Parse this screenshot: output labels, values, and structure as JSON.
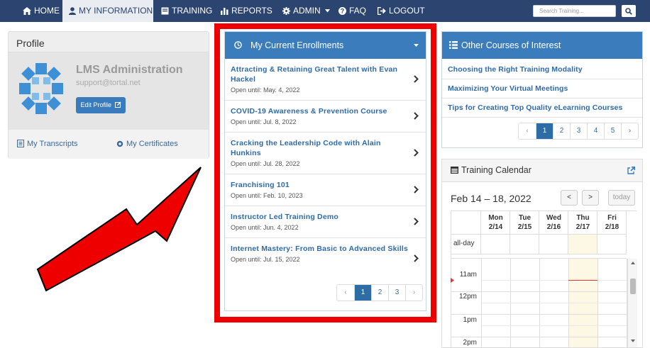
{
  "nav": {
    "home": "HOME",
    "my_information": "MY INFORMATION",
    "training": "TRAINING",
    "reports": "REPORTS",
    "admin": "ADMIN",
    "faq": "FAQ",
    "logout": "LOGOUT",
    "search_placeholder": "Search Training..."
  },
  "profile": {
    "title": "Profile",
    "name": "LMS Administration",
    "email": "support@tortal.net",
    "edit_label": "Edit Profile",
    "transcripts_label": "My Transcripts",
    "certificates_label": "My Certificates"
  },
  "enrollments": {
    "title": "My Current Enrollments",
    "items": [
      {
        "title": "Attracting & Retaining Great Talent with Evan Hackel",
        "date": "Open until: May. 4, 2022"
      },
      {
        "title": "COVID-19 Awareness & Prevention Course",
        "date": "Open until: Jul. 8, 2022"
      },
      {
        "title": "Cracking the Leadership Code with Alain Hunkins",
        "date": "Open until: Jul. 28, 2022"
      },
      {
        "title": "Franchising 101",
        "date": "Open until: Feb. 10, 2023"
      },
      {
        "title": "Instructor Led Training Demo",
        "date": "Open until: Jun. 4, 2022"
      },
      {
        "title": "Internet Mastery: From Basic to Advanced Skills",
        "date": "Open until: Jul. 15, 2022"
      }
    ],
    "pager": {
      "prev": "‹",
      "pages": [
        "1",
        "2",
        "3"
      ],
      "next": "›",
      "active": "1"
    }
  },
  "other_courses": {
    "title": "Other Courses of Interest",
    "items": [
      "Choosing the Right Training Modality",
      "Maximizing Your Virtual Meetings",
      "Tips for Creating Top Quality eLearning Courses"
    ],
    "pager": {
      "prev": "‹",
      "pages": [
        "1",
        "2",
        "3",
        "4",
        "5"
      ],
      "next": "›",
      "active": "1"
    }
  },
  "calendar": {
    "title": "Training Calendar",
    "range": "Feb 14 – 18, 2022",
    "prev": "<",
    "next": ">",
    "today": "today",
    "days": [
      {
        "name": "Mon",
        "date": "2/14"
      },
      {
        "name": "Tue",
        "date": "2/15"
      },
      {
        "name": "Wed",
        "date": "2/16"
      },
      {
        "name": "Thu",
        "date": "2/17"
      },
      {
        "name": "Fri",
        "date": "2/18"
      }
    ],
    "allday": "all-day",
    "times": [
      "11am",
      "12pm",
      "1pm",
      "2pm"
    ]
  },
  "colors": {
    "navbar": "#2b4470",
    "panel_header": "#3b7cbd",
    "highlight_frame": "#ee0000",
    "today_column": "#fcf8e3"
  }
}
